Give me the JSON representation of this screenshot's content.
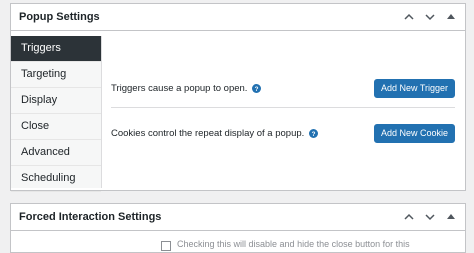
{
  "popup_settings": {
    "title": "Popup Settings",
    "tabs": [
      {
        "label": "Triggers",
        "active": true
      },
      {
        "label": "Targeting"
      },
      {
        "label": "Display"
      },
      {
        "label": "Close"
      },
      {
        "label": "Advanced"
      },
      {
        "label": "Scheduling"
      }
    ],
    "triggers_text": "Triggers cause a popup to open.",
    "add_trigger_label": "Add New Trigger",
    "cookies_text": "Cookies control the repeat display of a popup.",
    "add_cookie_label": "Add New Cookie"
  },
  "forced_interaction": {
    "title": "Forced Interaction Settings",
    "partial_text": "Checking this will disable and hide the close button for this"
  },
  "colors": {
    "accent": "#2271b1",
    "active_tab": "#2c3338"
  }
}
